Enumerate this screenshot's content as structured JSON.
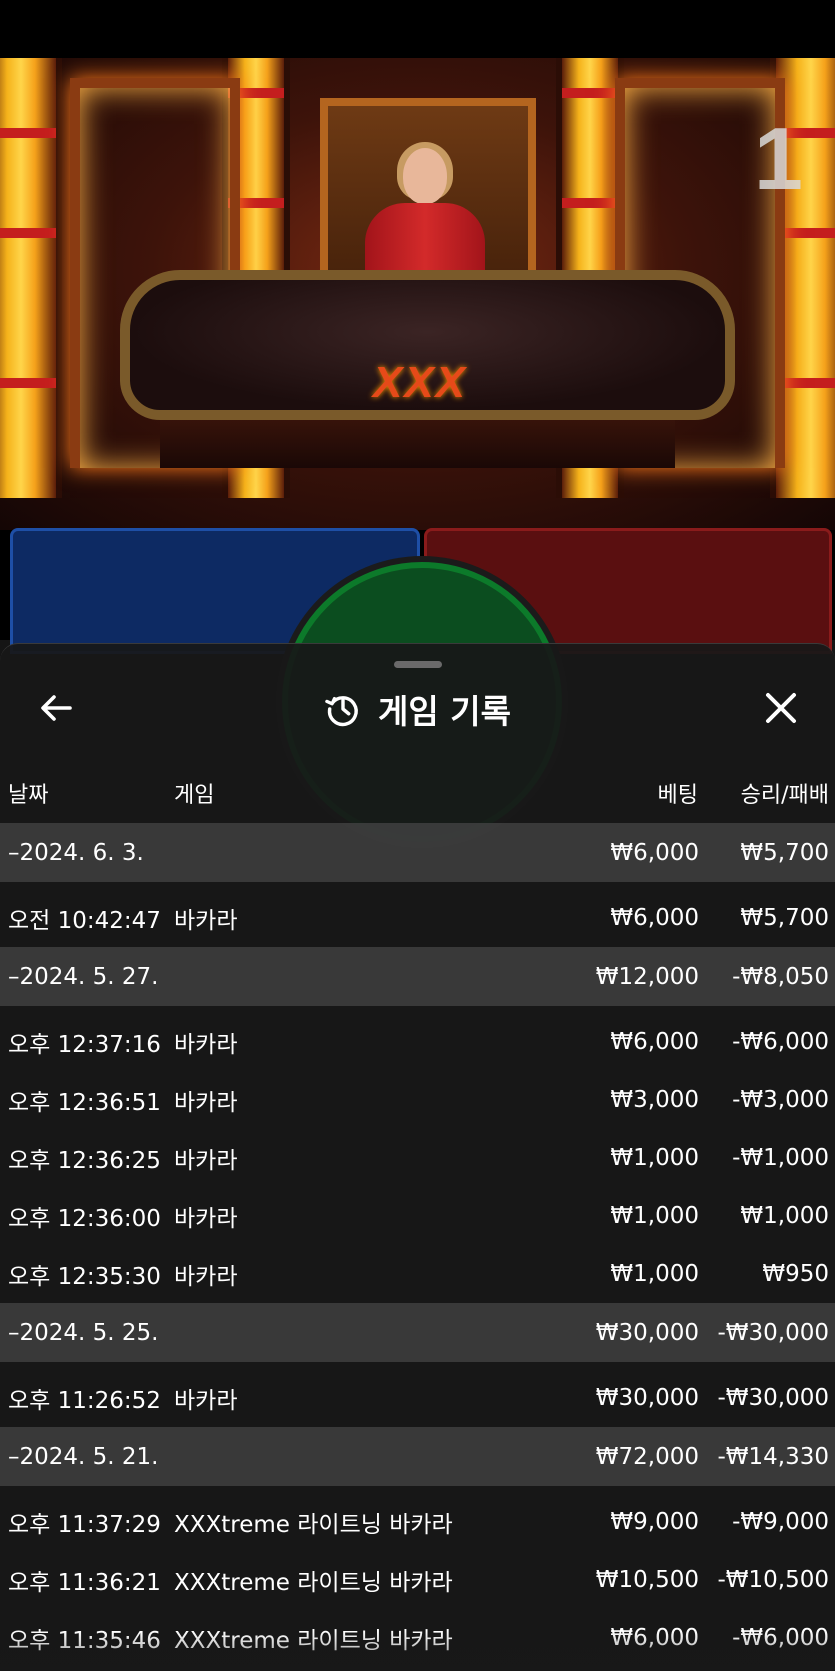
{
  "video": {
    "round_number": "1",
    "table_logo": "XXX"
  },
  "sheet": {
    "title": "게임 기록",
    "icons": {
      "back": "arrow-left-icon",
      "history": "history-icon",
      "close": "close-icon"
    },
    "columns": {
      "date": "날짜",
      "game": "게임",
      "bet": "베팅",
      "result": "승리/패배"
    },
    "groups": [
      {
        "date": "–2024. 6. 3.",
        "bet": "₩6,000",
        "result": "₩5,700",
        "games": [
          {
            "time": "오전 10:42:47",
            "game": "바카라",
            "bet": "₩6,000",
            "result": "₩5,700"
          }
        ]
      },
      {
        "date": "–2024. 5. 27.",
        "bet": "₩12,000",
        "result": "-₩8,050",
        "games": [
          {
            "time": "오후 12:37:16",
            "game": "바카라",
            "bet": "₩6,000",
            "result": "-₩6,000"
          },
          {
            "time": "오후 12:36:51",
            "game": "바카라",
            "bet": "₩3,000",
            "result": "-₩3,000"
          },
          {
            "time": "오후 12:36:25",
            "game": "바카라",
            "bet": "₩1,000",
            "result": "-₩1,000"
          },
          {
            "time": "오후 12:36:00",
            "game": "바카라",
            "bet": "₩1,000",
            "result": "₩1,000"
          },
          {
            "time": "오후 12:35:30",
            "game": "바카라",
            "bet": "₩1,000",
            "result": "₩950"
          }
        ]
      },
      {
        "date": "–2024. 5. 25.",
        "bet": "₩30,000",
        "result": "-₩30,000",
        "games": [
          {
            "time": "오후 11:26:52",
            "game": "바카라",
            "bet": "₩30,000",
            "result": "-₩30,000"
          }
        ]
      },
      {
        "date": "–2024. 5. 21.",
        "bet": "₩72,000",
        "result": "-₩14,330",
        "games": [
          {
            "time": "오후 11:37:29",
            "game": "XXXtreme 라이트닝 바카라",
            "bet": "₩9,000",
            "result": "-₩9,000"
          },
          {
            "time": "오후 11:36:21",
            "game": "XXXtreme 라이트닝 바카라",
            "bet": "₩10,500",
            "result": "-₩10,500"
          },
          {
            "time": "오후 11:35:46",
            "game": "XXXtreme 라이트닝 바카라",
            "bet": "₩6,000",
            "result": "-₩6,000"
          }
        ]
      }
    ]
  }
}
